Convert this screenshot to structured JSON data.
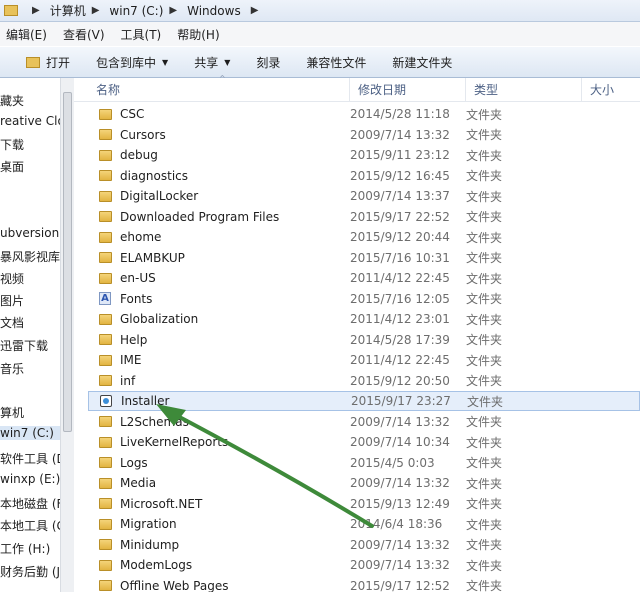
{
  "address": {
    "crumbs": [
      "计算机",
      "win7 (C:)",
      "Windows"
    ]
  },
  "menu": {
    "edit": "编辑(E)",
    "view": "查看(V)",
    "tools": "工具(T)",
    "help": "帮助(H)"
  },
  "toolbar": {
    "open": "打开",
    "include_library": "包含到库中",
    "share": "共享",
    "burn": "刻录",
    "compat_files": "兼容性文件",
    "new_folder": "新建文件夹"
  },
  "nav": {
    "items": [
      "藏夹",
      "reative Clo",
      "下载",
      "桌面",
      "ubversion",
      "暴风影视库",
      "视频",
      "图片",
      "文档",
      "迅雷下载",
      "音乐",
      "算机",
      "win7 (C:)",
      "软件工具 (D:",
      "winxp (E:)",
      "本地磁盘 (F:",
      "本地工具 (G:",
      "工作 (H:)",
      "财务后勤 (J:"
    ]
  },
  "columns": {
    "name": "名称",
    "date": "修改日期",
    "type": "类型",
    "size": "大小"
  },
  "files": [
    {
      "name": "CSC",
      "date": "2014/5/28 11:18",
      "type": "文件夹",
      "icon": "folder-icon"
    },
    {
      "name": "Cursors",
      "date": "2009/7/14 13:32",
      "type": "文件夹",
      "icon": "folder-icon"
    },
    {
      "name": "debug",
      "date": "2015/9/11 23:12",
      "type": "文件夹",
      "icon": "folder-icon"
    },
    {
      "name": "diagnostics",
      "date": "2015/9/12 16:45",
      "type": "文件夹",
      "icon": "folder-icon"
    },
    {
      "name": "DigitalLocker",
      "date": "2009/7/14 13:37",
      "type": "文件夹",
      "icon": "folder-icon"
    },
    {
      "name": "Downloaded Program Files",
      "date": "2015/9/17 22:52",
      "type": "文件夹",
      "icon": "folder-icon"
    },
    {
      "name": "ehome",
      "date": "2015/9/12 20:44",
      "type": "文件夹",
      "icon": "folder-icon"
    },
    {
      "name": "ELAMBKUP",
      "date": "2015/7/16 10:31",
      "type": "文件夹",
      "icon": "folder-icon"
    },
    {
      "name": "en-US",
      "date": "2011/4/12 22:45",
      "type": "文件夹",
      "icon": "folder-icon"
    },
    {
      "name": "Fonts",
      "date": "2015/7/16 12:05",
      "type": "文件夹",
      "icon": "fonts-icon"
    },
    {
      "name": "Globalization",
      "date": "2011/4/12 23:01",
      "type": "文件夹",
      "icon": "folder-icon"
    },
    {
      "name": "Help",
      "date": "2014/5/28 17:39",
      "type": "文件夹",
      "icon": "folder-icon"
    },
    {
      "name": "IME",
      "date": "2011/4/12 22:45",
      "type": "文件夹",
      "icon": "folder-icon"
    },
    {
      "name": "inf",
      "date": "2015/9/12 20:50",
      "type": "文件夹",
      "icon": "folder-icon"
    },
    {
      "name": "Installer",
      "date": "2015/9/17 23:27",
      "type": "文件夹",
      "icon": "installer-icon",
      "selected": true
    },
    {
      "name": "L2Schemas",
      "date": "2009/7/14 13:32",
      "type": "文件夹",
      "icon": "folder-icon"
    },
    {
      "name": "LiveKernelReports",
      "date": "2009/7/14 10:34",
      "type": "文件夹",
      "icon": "folder-icon"
    },
    {
      "name": "Logs",
      "date": "2015/4/5 0:03",
      "type": "文件夹",
      "icon": "folder-icon"
    },
    {
      "name": "Media",
      "date": "2009/7/14 13:32",
      "type": "文件夹",
      "icon": "folder-icon"
    },
    {
      "name": "Microsoft.NET",
      "date": "2015/9/13 12:49",
      "type": "文件夹",
      "icon": "folder-icon"
    },
    {
      "name": "Migration",
      "date": "2014/6/4 18:36",
      "type": "文件夹",
      "icon": "folder-icon"
    },
    {
      "name": "Minidump",
      "date": "2009/7/14 13:32",
      "type": "文件夹",
      "icon": "folder-icon"
    },
    {
      "name": "ModemLogs",
      "date": "2009/7/14 13:32",
      "type": "文件夹",
      "icon": "folder-icon"
    },
    {
      "name": "Offline Web Pages",
      "date": "2015/9/17 12:52",
      "type": "文件夹",
      "icon": "folder-icon"
    }
  ],
  "annotation": {
    "arrow_color": "#3e8a3a"
  }
}
